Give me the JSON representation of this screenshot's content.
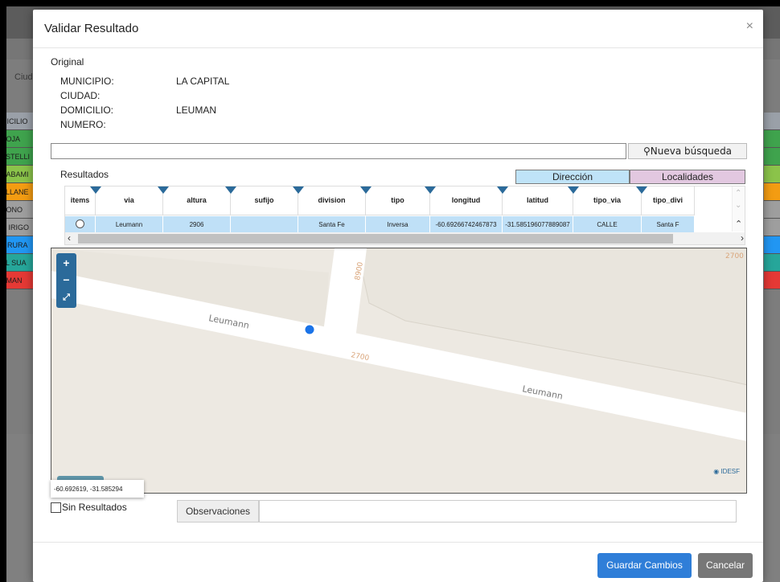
{
  "background": {
    "ciudad_label": "Ciud",
    "left_rows": [
      {
        "text": "MICILIO",
        "color": "#9aa0a8"
      },
      {
        "text": "ROJA",
        "color": "#3fa34d"
      },
      {
        "text": "ASTELLI",
        "color": "#3fa34d"
      },
      {
        "text": "HABAMI",
        "color": "#8bc34a"
      },
      {
        "text": "ELLANE",
        "color": "#f39c12"
      },
      {
        "text": "RONO",
        "color": "#9e9e9e"
      },
      {
        "text": "O IRIGO",
        "color": "#9e9e9e"
      },
      {
        "text": "A RURA",
        "color": "#2196f3"
      },
      {
        "text": "EL SUA",
        "color": "#26a69a"
      },
      {
        "text": "UMAN",
        "color": "#e53935"
      }
    ]
  },
  "modal": {
    "title": "Validar Resultado",
    "close": "×"
  },
  "original": {
    "section_title": "Original",
    "municipio_label": "MUNICIPIO:",
    "municipio_value": "LA CAPITAL",
    "ciudad_label": "CIUDAD:",
    "ciudad_value": "",
    "domicilio_label": "DOMICILIO:",
    "domicilio_value": "LEUMAN",
    "numero_label": "NUMERO:",
    "numero_value": ""
  },
  "search": {
    "value": "",
    "button_label": "Nueva búsqueda"
  },
  "results": {
    "title": "Resultados",
    "tab_direccion": "Dirección",
    "tab_localidades": "Localidades",
    "columns": [
      "items",
      "via",
      "altura",
      "sufijo",
      "division",
      "tipo",
      "longitud",
      "latitud",
      "tipo_via",
      "tipo_divi"
    ],
    "row": [
      "",
      "Leumann",
      "2906",
      "",
      "Santa Fe",
      "Inversa",
      "-60.69266742467873",
      "-31.585196077889087",
      "CALLE",
      "Santa F"
    ]
  },
  "map": {
    "labels": {
      "street1": "Leumann",
      "street2": "Leumann",
      "num1": "8900",
      "num2": "2700",
      "num3": "2700"
    },
    "coordinates": "-60.692619, -31.585294",
    "attribution": "IDESF",
    "colors": {
      "street": "#ffffff",
      "block": "#ede9e2",
      "marker": "#1a73e8",
      "zoom": "#2b6a9a"
    }
  },
  "footer": {
    "sin_resultados": "Sin Resultados",
    "observaciones_label": "Observaciones",
    "observaciones_value": "",
    "save": "Guardar Cambios",
    "cancel": "Cancelar"
  }
}
